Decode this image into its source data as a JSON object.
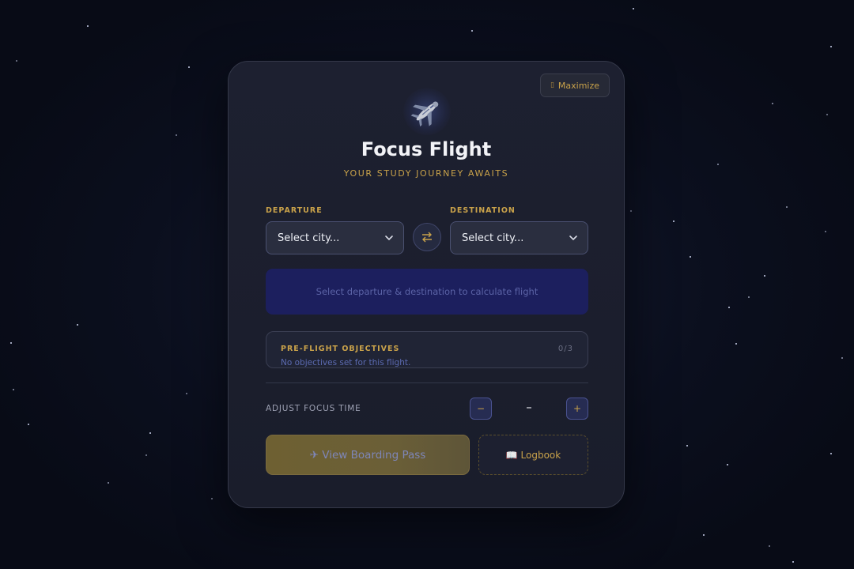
{
  "header": {
    "maximize_label": "Maximize",
    "title": "Focus Flight",
    "subtitle": "YOUR STUDY JOURNEY AWAITS"
  },
  "route": {
    "departure_label": "DEPARTURE",
    "departure_value": "Select city...",
    "destination_label": "DESTINATION",
    "destination_value": "Select city...",
    "prompt": "Select departure & destination to calculate flight"
  },
  "objectives": {
    "title": "PRE-FLIGHT OBJECTIVES",
    "count": "0/3",
    "empty_text": "No objectives set for this flight."
  },
  "focus_time": {
    "label": "ADJUST FOCUS TIME",
    "value": "–",
    "minus": "−",
    "plus": "+"
  },
  "actions": {
    "boarding_pass": "✈ View Boarding Pass",
    "logbook": "📖 Logbook"
  },
  "colors": {
    "accent_gold": "#c9a24a",
    "panel_bg": "#1d2030",
    "route_box_bg": "#1c1f5e"
  },
  "icons": {
    "airplane": "airplane-icon",
    "swap": "swap-arrows-icon",
    "chevron": "chevron-down-icon",
    "book": "book-icon"
  }
}
